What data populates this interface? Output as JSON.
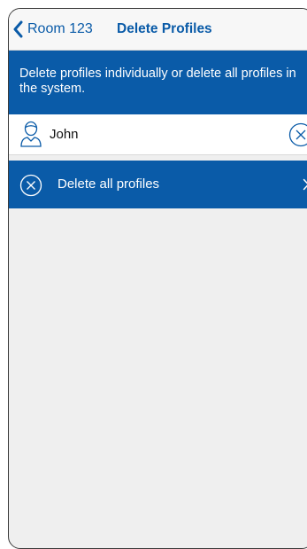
{
  "nav": {
    "back_label": "Room 123",
    "title": "Delete Profiles"
  },
  "info": {
    "text": "Delete profiles individually or delete all profiles in the system."
  },
  "profiles": [
    {
      "name": "John"
    }
  ],
  "delete_all": {
    "label": "Delete all profiles"
  },
  "colors": {
    "accent": "#0a5ba8",
    "background": "#efefef"
  },
  "icons": {
    "back": "chevron-left-icon",
    "user": "user-icon",
    "remove": "circle-x-icon",
    "forward": "chevron-right-icon"
  }
}
